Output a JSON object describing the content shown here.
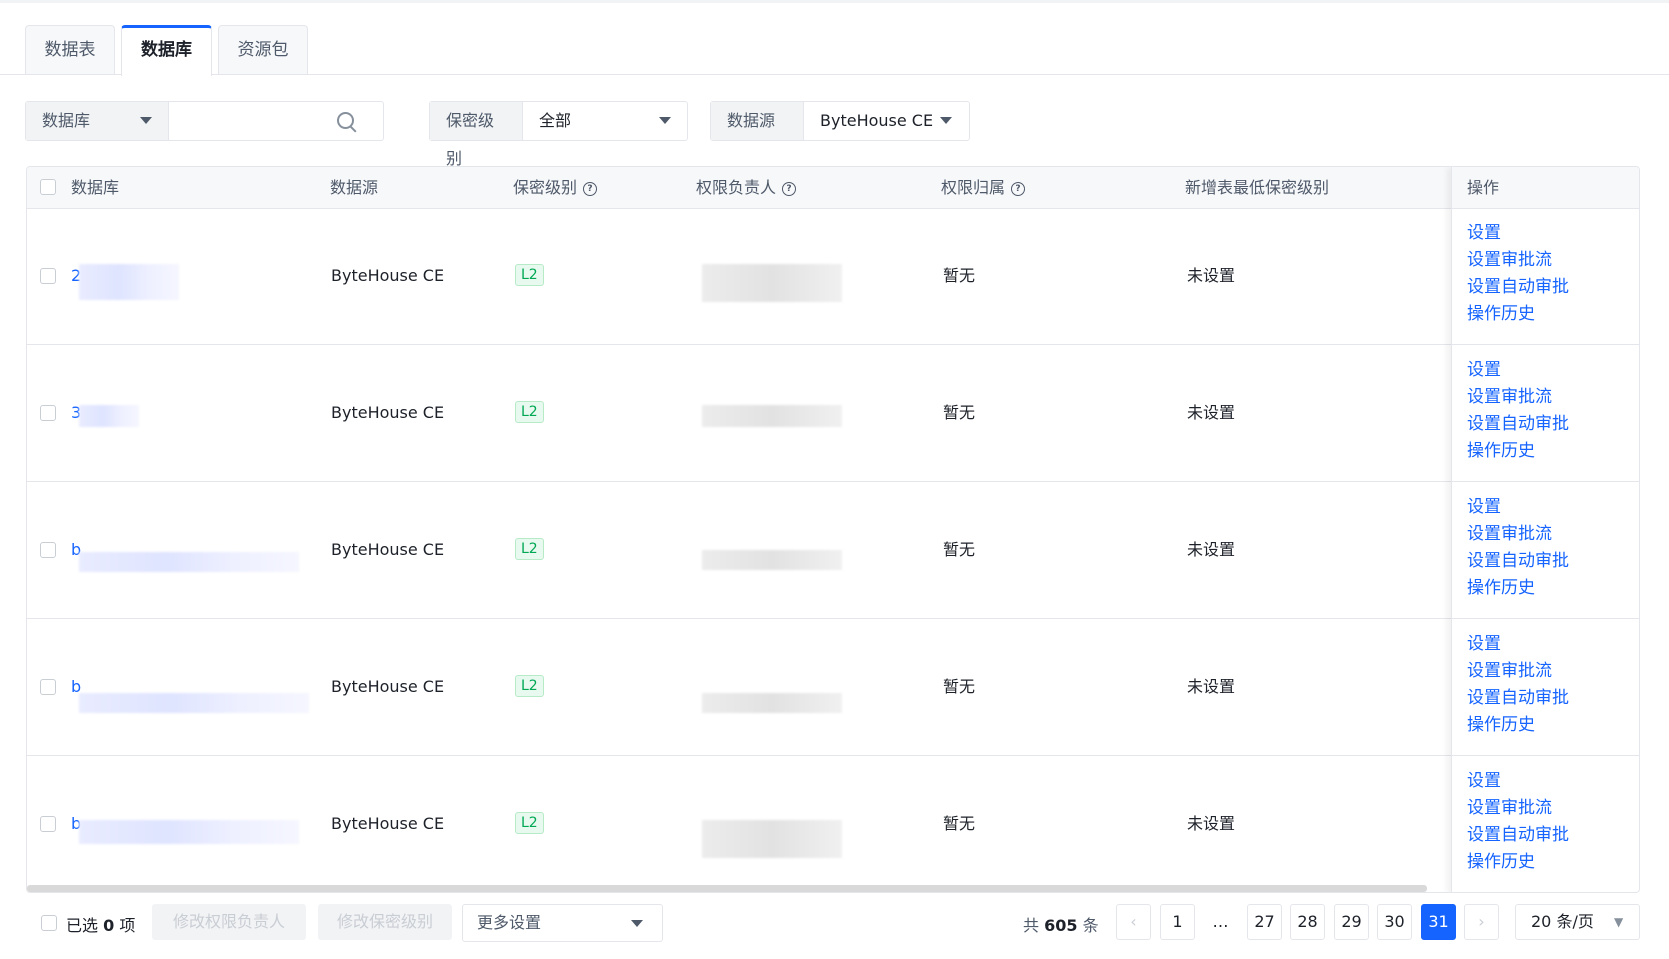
{
  "tabs": [
    {
      "label": "数据表",
      "active": false
    },
    {
      "label": "数据库",
      "active": true
    },
    {
      "label": "资源包",
      "active": false
    }
  ],
  "filters": {
    "db_type": "数据库",
    "search_placeholder": "",
    "level_label": "保密级别",
    "level_value": "全部",
    "source_label": "数据源",
    "source_value": "ByteHouse CE"
  },
  "columns": [
    "数据库",
    "数据源",
    "保密级别",
    "权限负责人",
    "权限归属",
    "新增表最低保密级别",
    "操作"
  ],
  "rows": [
    {
      "database": "2",
      "source": "ByteHouse CE",
      "level": "L2",
      "owner": "",
      "ownership": "暂无",
      "min_level": "未设置"
    },
    {
      "database": "3",
      "source": "ByteHouse CE",
      "level": "L2",
      "owner": "",
      "ownership": "暂无",
      "min_level": "未设置"
    },
    {
      "database": "b",
      "source": "ByteHouse CE",
      "level": "L2",
      "owner": "",
      "ownership": "暂无",
      "min_level": "未设置"
    },
    {
      "database": "b",
      "source": "ByteHouse CE",
      "level": "L2",
      "owner": "",
      "ownership": "暂无",
      "min_level": "未设置"
    },
    {
      "database": "b",
      "source": "ByteHouse CE",
      "level": "L2",
      "owner": "",
      "ownership": "暂无",
      "min_level": "未设置"
    }
  ],
  "row_actions": [
    "设置",
    "设置审批流",
    "设置自动审批",
    "操作历史"
  ],
  "footer": {
    "selected_prefix": "已选",
    "selected_count": "0",
    "selected_suffix": "项",
    "btn_owner": "修改权限负责人",
    "btn_level": "修改保密级别",
    "more_settings": "更多设置",
    "total_prefix": "共",
    "total_count": "605",
    "total_suffix": "条",
    "pages": [
      "1",
      "…",
      "27",
      "28",
      "29",
      "30",
      "31"
    ],
    "current_page": "31",
    "page_size": "20 条/页"
  },
  "colors": {
    "accent": "#1664ff",
    "tag_green": "#00a854"
  }
}
